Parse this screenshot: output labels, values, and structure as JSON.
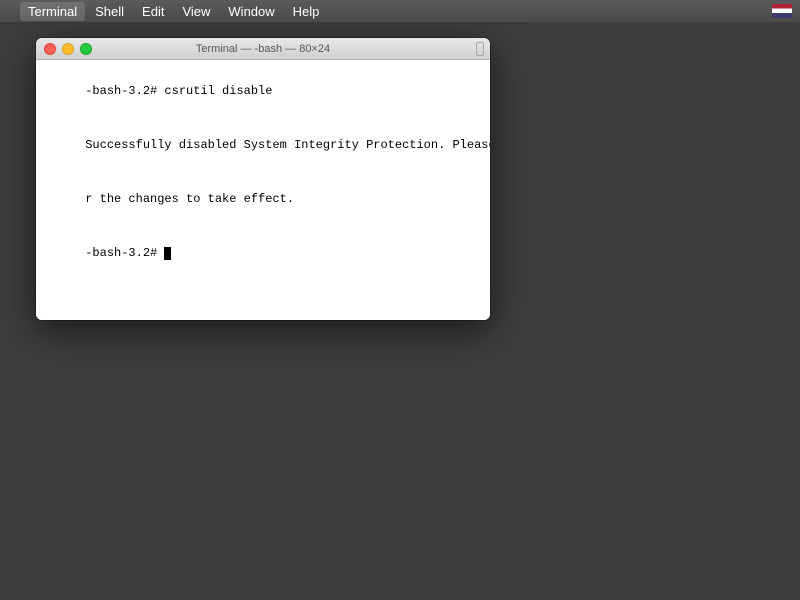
{
  "menubar": {
    "apple_symbol": "",
    "items": [
      {
        "label": "Terminal",
        "active": true
      },
      {
        "label": "Shell"
      },
      {
        "label": "Edit"
      },
      {
        "label": "View"
      },
      {
        "label": "Window"
      },
      {
        "label": "Help"
      }
    ]
  },
  "terminal": {
    "title": "Terminal — -bash — 80×24",
    "lines": [
      "-bash-3.2# csrutil disable",
      "Successfully disabled System Integrity Protection. Please restart the machine fo",
      "r the changes to take effect.",
      "-bash-3.2# "
    ]
  }
}
